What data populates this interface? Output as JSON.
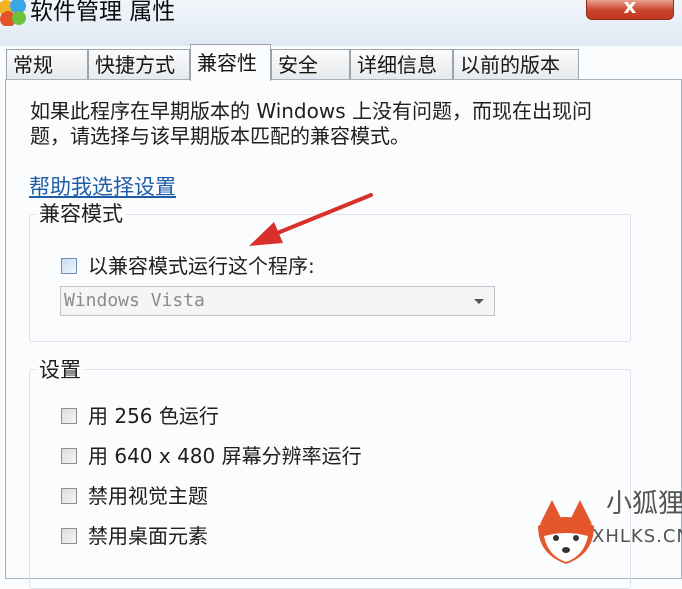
{
  "window": {
    "title": "软件管理 属性",
    "close_glyph": "x",
    "close_color": "#c9432a"
  },
  "tabs": [
    {
      "label": "常规",
      "active": false
    },
    {
      "label": "快捷方式",
      "active": false
    },
    {
      "label": "兼容性",
      "active": true
    },
    {
      "label": "安全",
      "active": false
    },
    {
      "label": "详细信息",
      "active": false
    },
    {
      "label": "以前的版本",
      "active": false
    }
  ],
  "compat": {
    "description": "如果此程序在早期版本的 Windows 上没有问题，而现在出现问题，请选择与该早期版本匹配的兼容模式。",
    "help_link": "帮助我选择设置",
    "mode_group": {
      "title": "兼容模式",
      "run_in_mode_label": "以兼容模式运行这个程序:",
      "run_in_mode_checked": false,
      "os_select_value": "Windows Vista",
      "os_select_enabled": false
    },
    "settings_group": {
      "title": "设置",
      "items": [
        {
          "label": "用 256 色运行",
          "checked": false
        },
        {
          "label": "用 640 x 480 屏幕分辨率运行",
          "checked": false
        },
        {
          "label": "禁用视觉主题",
          "checked": false
        },
        {
          "label": "禁用桌面元素",
          "checked": false
        }
      ]
    }
  },
  "annotation": {
    "color": "#d9302b"
  },
  "watermark": {
    "text_cn": "小狐狸网",
    "text_en": "XHLKS.CN"
  },
  "colors": {
    "link": "#1f5ca8",
    "accent": "#d9302b",
    "watermark_orange": "#e4562c"
  }
}
